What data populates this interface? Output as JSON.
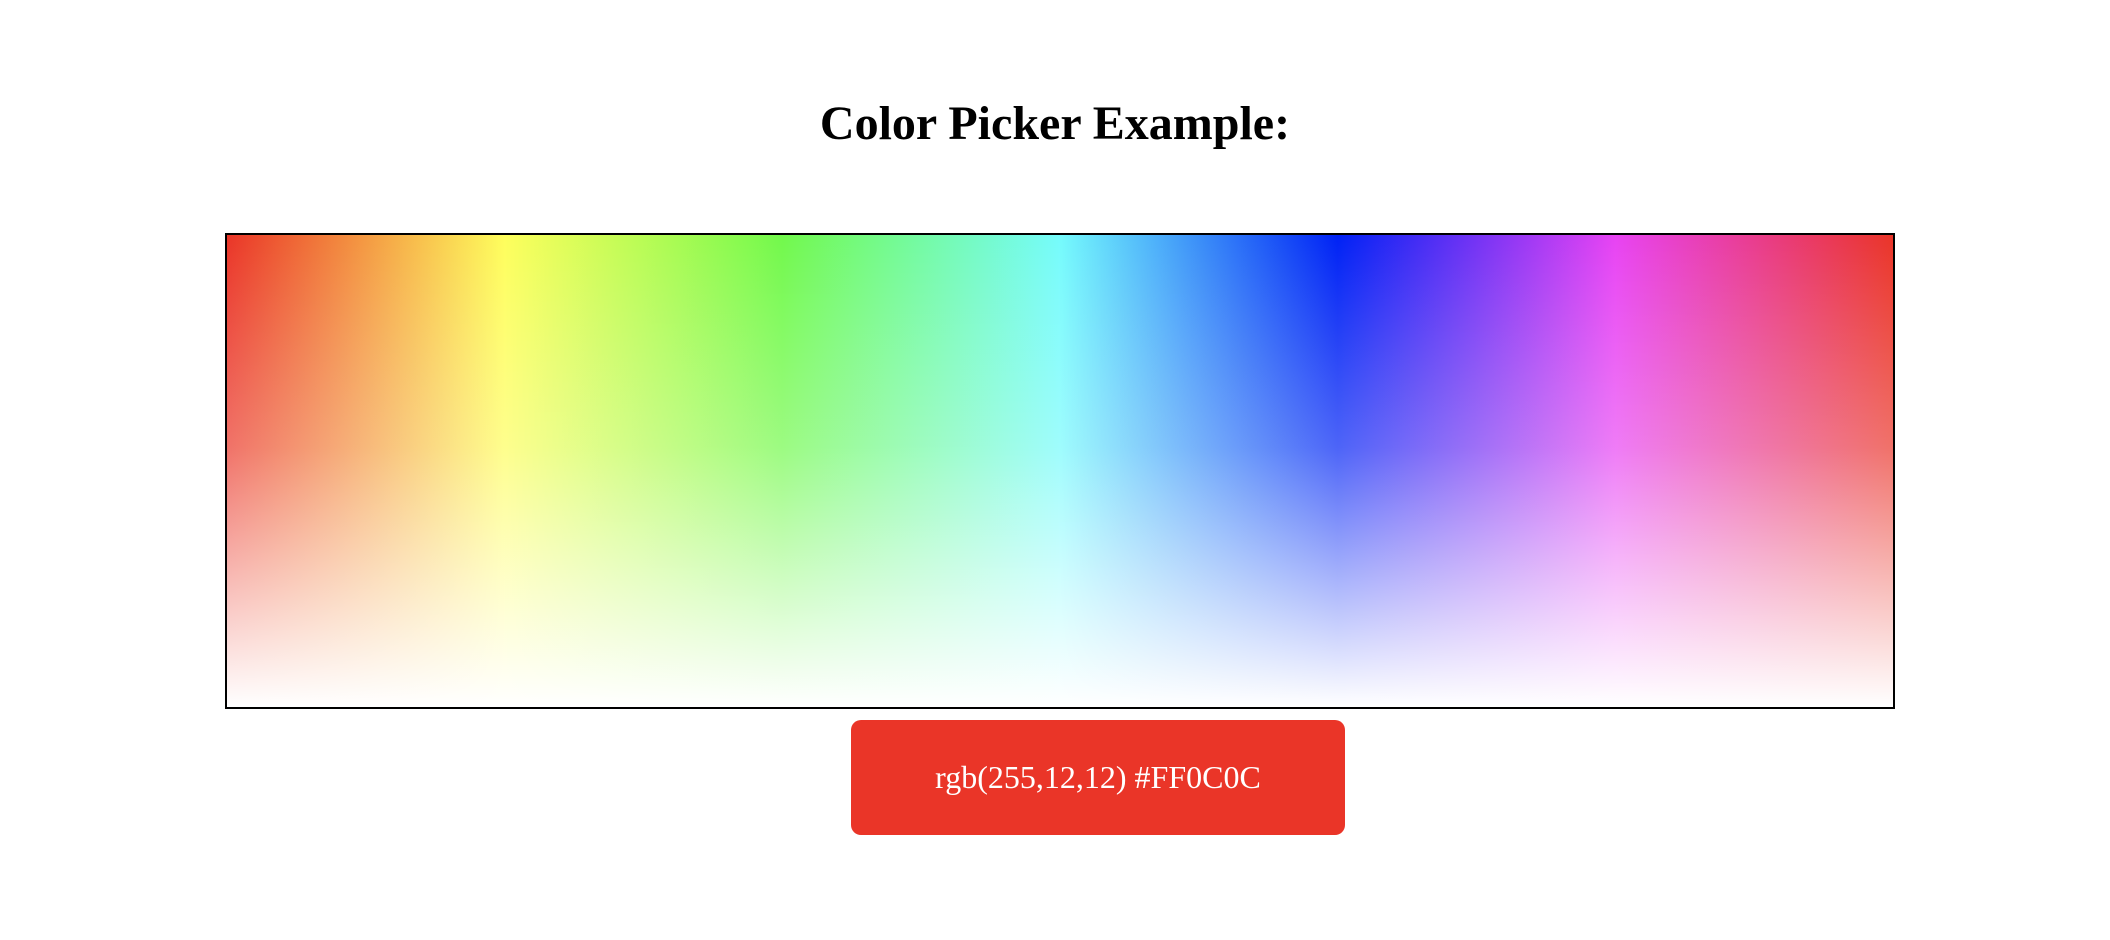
{
  "page": {
    "title": "Color Picker Example:"
  },
  "palette": {
    "hue_stops": [
      "#ea3528",
      "#fefe5c",
      "#72f94c",
      "#75fbfc",
      "#0022f5",
      "#e843f3",
      "#ea3528"
    ],
    "fade_to": "#ffffff"
  },
  "selected_color": {
    "rgb": "rgb(255,12,12)",
    "hex": "#FF0C0C",
    "label": "rgb(255,12,12) #FF0C0C",
    "swatch_color": "#ea3528",
    "text_color": "#ffffff"
  }
}
